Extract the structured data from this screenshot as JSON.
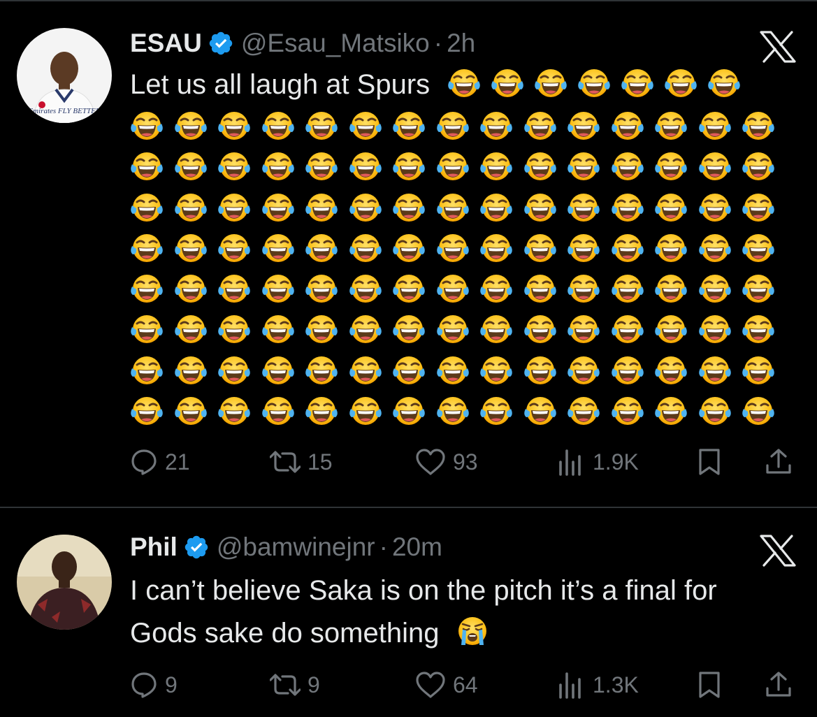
{
  "tweets": [
    {
      "author": {
        "name": "ESAU",
        "verified": true,
        "handle": "@Esau_Matsiko",
        "separator": "·",
        "time": "2h",
        "avatar_jersey_text": "Emirates FLY BETTER"
      },
      "text": "Let us all laugh at Spurs",
      "inline_emoji_count": 7,
      "emoji_grid": {
        "rows": 8,
        "columns": 15,
        "emoji": "face-with-tears-of-joy"
      },
      "emoji_name": "face-with-tears-of-joy",
      "stats": {
        "replies": "21",
        "reposts": "15",
        "likes": "93",
        "views": "1.9K"
      }
    },
    {
      "author": {
        "name": "Phil",
        "verified": true,
        "handle": "@bamwinejnr",
        "separator": "·",
        "time": "20m"
      },
      "text_line1": "I can’t believe Saka is on the pitch it’s a final for",
      "text_line2": "Gods sake do something",
      "emoji_name": "loudly-crying-face",
      "stats": {
        "replies": "9",
        "reposts": "9",
        "likes": "64",
        "views": "1.3K"
      }
    }
  ],
  "colors": {
    "background": "#000000",
    "primary_text": "#e7e9ea",
    "secondary_text": "#71767b",
    "verified_blue": "#1d9bf0",
    "divider": "#2f3336"
  },
  "icons": {
    "reply": "reply-icon",
    "repost": "repost-icon",
    "like": "heart-icon",
    "views": "views-chart-icon",
    "bookmark": "bookmark-icon",
    "share": "share-icon",
    "platform": "x-logo-icon"
  }
}
